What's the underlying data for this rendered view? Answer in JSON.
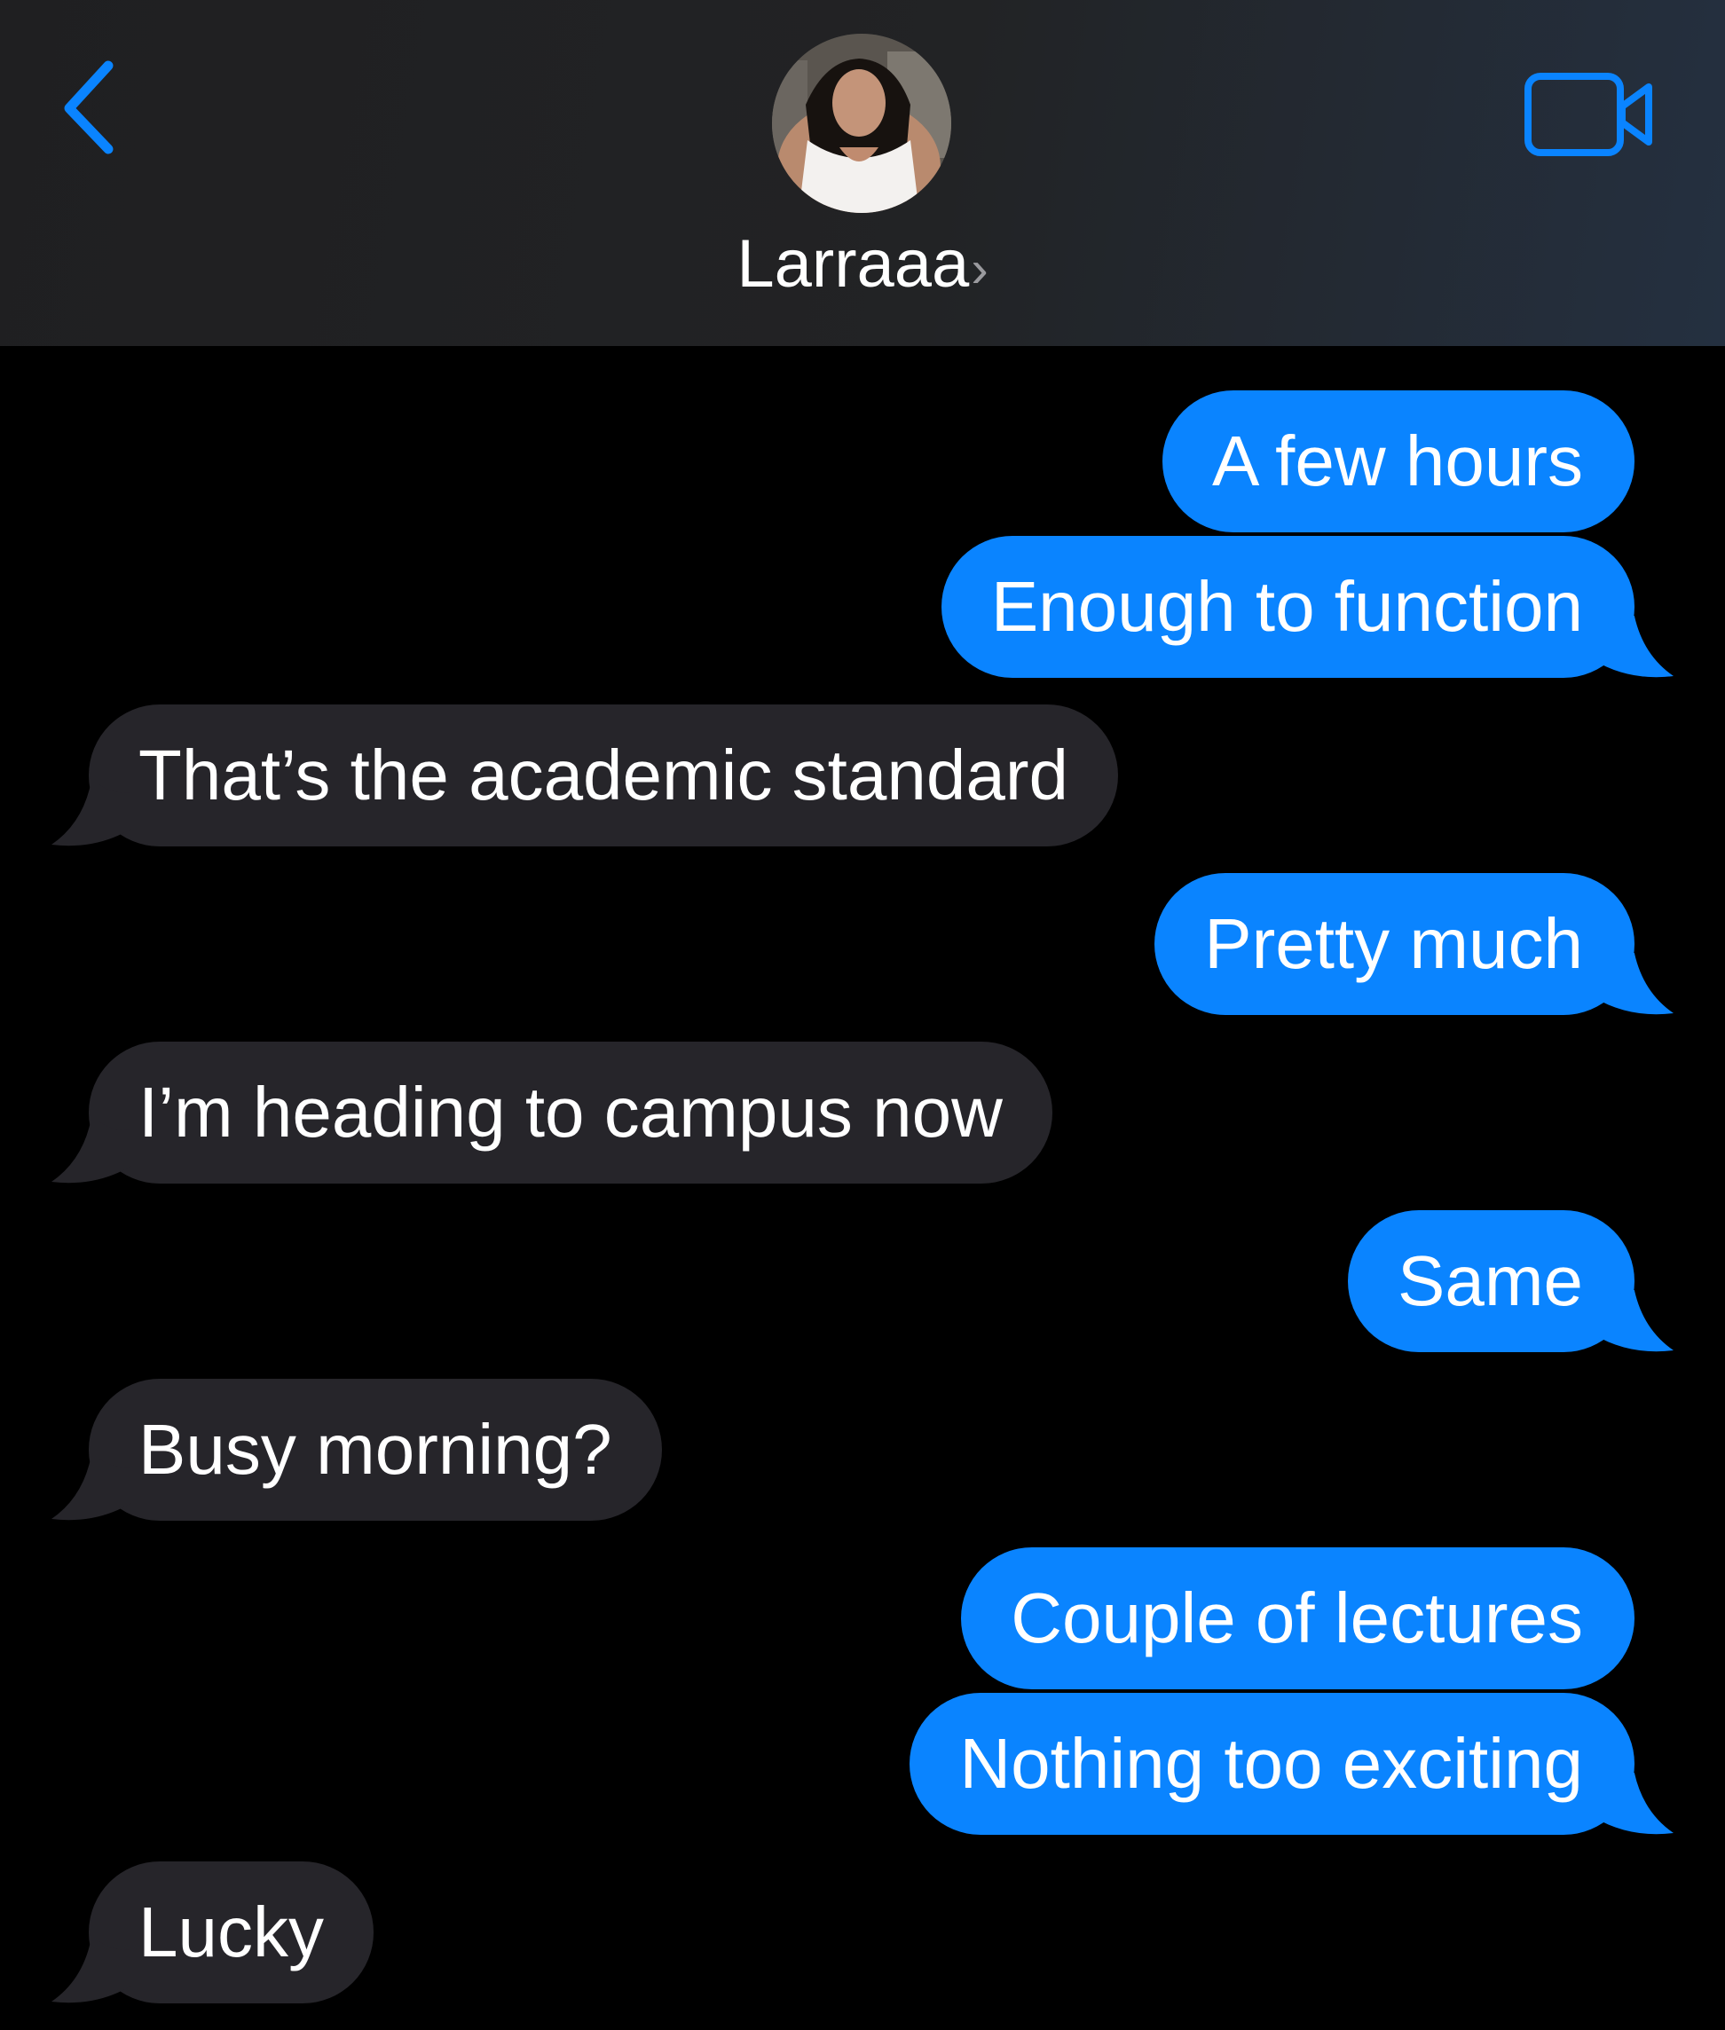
{
  "header": {
    "contact_name": "Larraaa",
    "name_chevron": "›",
    "back_icon": "chevron-left-icon",
    "video_icon": "video-camera-icon",
    "accent_color": "#0a84ff"
  },
  "messages": [
    {
      "direction": "sent",
      "text": "A few hours"
    },
    {
      "direction": "sent",
      "text": "Enough to function"
    },
    {
      "direction": "received",
      "text": "That’s the academic standard"
    },
    {
      "direction": "sent",
      "text": "Pretty much"
    },
    {
      "direction": "received",
      "text": "I’m heading to campus now"
    },
    {
      "direction": "sent",
      "text": "Same"
    },
    {
      "direction": "received",
      "text": "Busy morning?"
    },
    {
      "direction": "sent",
      "text": "Couple of lectures"
    },
    {
      "direction": "sent",
      "text": "Nothing too exciting"
    },
    {
      "direction": "received",
      "text": "Lucky"
    }
  ],
  "colors": {
    "sent_bubble": "#0a84ff",
    "received_bubble": "#26252a",
    "background": "#000000"
  }
}
